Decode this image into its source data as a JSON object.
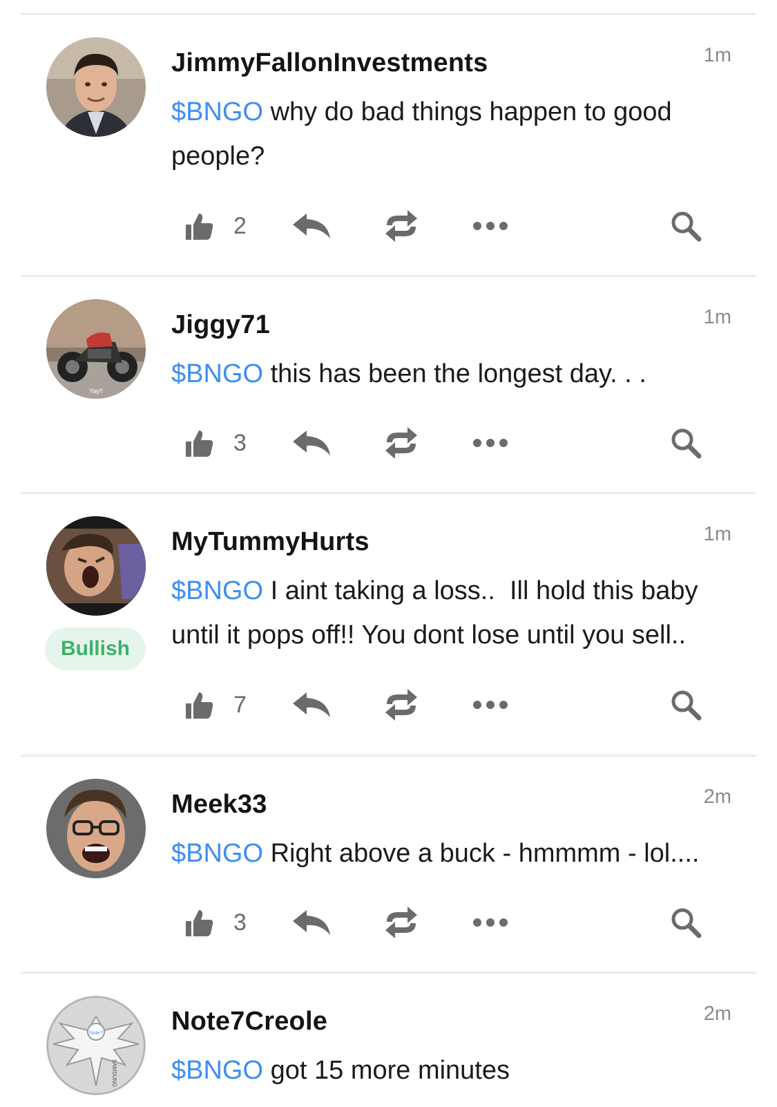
{
  "posts": [
    {
      "username": "JimmyFallonInvestments",
      "time": "1m",
      "cashtag": "$BNGO",
      "text_line1": " why do bad things happen to good",
      "text_line2": "people?",
      "likes": "2",
      "sentiment": ""
    },
    {
      "username": "Jiggy71",
      "time": "1m",
      "cashtag": "$BNGO",
      "text_line1": " this has been the longest day. . .",
      "text_line2": "",
      "likes": "3",
      "sentiment": ""
    },
    {
      "username": "MyTummyHurts",
      "time": "1m",
      "cashtag": "$BNGO",
      "text_line1": " I aint taking a loss..  Ill hold this baby",
      "text_line2": "until it pops off!!  You dont lose until you sell..",
      "likes": "7",
      "sentiment": "Bullish"
    },
    {
      "username": "Meek33",
      "time": "2m",
      "cashtag": "$BNGO",
      "text_line1": " Right above a buck - hmmmm - lol....",
      "text_line2": "",
      "likes": "3",
      "sentiment": ""
    },
    {
      "username": "Note7Creole",
      "time": "2m",
      "cashtag": "$BNGO",
      "text_line1": " got 15 more minutes",
      "text_line2": "",
      "likes": "",
      "sentiment": ""
    }
  ],
  "avatar_labels": {
    "jiggy": "Yay!!",
    "note7_badge": "Note7",
    "note7_banner": "SAMSUNG"
  },
  "colors": {
    "cashtag": "#3d8ef0",
    "bullish_text": "#3fb06a",
    "bullish_bg": "#e6f5ec",
    "icon": "#6b6b6b"
  },
  "icons": {
    "like": "thumbs-up-icon",
    "reply": "reply-icon",
    "reshare": "reshare-icon",
    "more": "more-dots-icon",
    "search": "search-icon"
  }
}
